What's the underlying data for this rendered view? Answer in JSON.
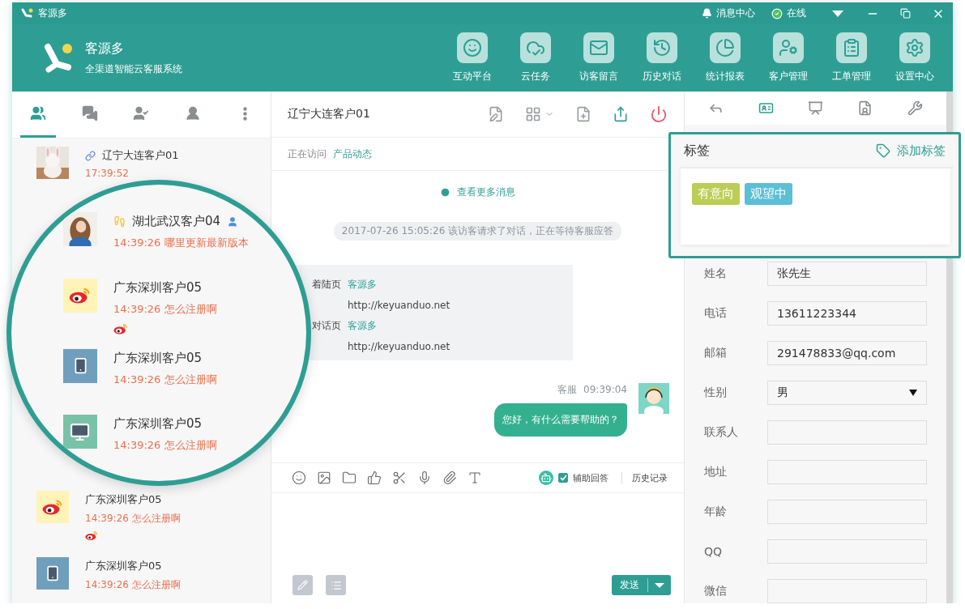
{
  "titlebar": {
    "app_name": "客源多",
    "notice": "消息中心",
    "status": "在线",
    "online": true
  },
  "header": {
    "brand": "客源多",
    "slogan": "全渠道智能云客服系统",
    "nav": [
      {
        "label": "互动平台"
      },
      {
        "label": "云任务"
      },
      {
        "label": "访客留言"
      },
      {
        "label": "历史对话"
      },
      {
        "label": "统计报表"
      },
      {
        "label": "客户管理"
      },
      {
        "label": "工单管理"
      },
      {
        "label": "设置中心"
      }
    ]
  },
  "left_tabs": [
    {
      "selected": true
    },
    {
      "selected": false
    },
    {
      "selected": false
    },
    {
      "selected": false
    },
    {
      "selected": false
    }
  ],
  "conversations": [
    {
      "name": "辽宁大连客户01",
      "message": "17:39:52",
      "linked": true
    },
    {
      "name": "广东深圳客户05",
      "message": "14:39:26 怎么注册啊",
      "kind": "weibo"
    },
    {
      "name": "广东深圳客户05",
      "message": "14:39:26 怎么注册啊",
      "kind": "mobile"
    }
  ],
  "magnifier": [
    {
      "name": "湖北武汉客户04",
      "message": "14:39:26 哪里更新最新版本",
      "footprint": true,
      "member": true
    },
    {
      "name": "广东深圳客户05",
      "message": "14:39:26 怎么注册啊",
      "kind": "weibo"
    },
    {
      "name": "广东深圳客户05",
      "message": "14:39:26 怎么注册啊",
      "kind": "mobile"
    },
    {
      "name": "广东深圳客户05",
      "message": "14:39:26 怎么注册啊",
      "kind": "desktop"
    }
  ],
  "chat": {
    "title": "辽宁大连客户01",
    "visiting_label": "正在访问",
    "visiting_page": "产品动态",
    "more": "查看更多消息",
    "notice": "2017-07-26 15:05:26 该访客请求了对话，正在等待客服应答",
    "visit": [
      {
        "label": "着陆页",
        "site": "客源多",
        "url": "http://keyuanduo.net"
      },
      {
        "label": "对话页",
        "site": "客源多",
        "url": "http://keyuanduo.net"
      }
    ],
    "messages": [
      {
        "sender": "客服",
        "time": "09:39:04",
        "text": "您好，有什么需要帮助的？"
      }
    ],
    "assist": {
      "label": "辅助回答",
      "checked": true
    },
    "history": "历史记录",
    "send": "发送"
  },
  "right": {
    "tabs": [
      {
        "selected": false
      },
      {
        "selected": true
      },
      {
        "selected": false
      },
      {
        "selected": false
      },
      {
        "selected": false
      }
    ],
    "tags": {
      "title": "标签",
      "add": "添加标签",
      "items": [
        {
          "label": "有意向",
          "color": "#bccd55"
        },
        {
          "label": "观望中",
          "color": "#5bbfd6"
        }
      ]
    },
    "fields": [
      {
        "label": "姓名",
        "value": "张先生",
        "kind": "text"
      },
      {
        "label": "电话",
        "value": "13611223344",
        "kind": "text"
      },
      {
        "label": "邮箱",
        "value": "291478833@qq.com",
        "kind": "text"
      },
      {
        "label": "性别",
        "value": "男",
        "kind": "select"
      },
      {
        "label": "联系人",
        "kind": "text"
      },
      {
        "label": "地址",
        "kind": "text"
      },
      {
        "label": "年龄",
        "kind": "text"
      },
      {
        "label": "QQ",
        "kind": "text"
      },
      {
        "label": "微信",
        "kind": "text"
      }
    ]
  }
}
